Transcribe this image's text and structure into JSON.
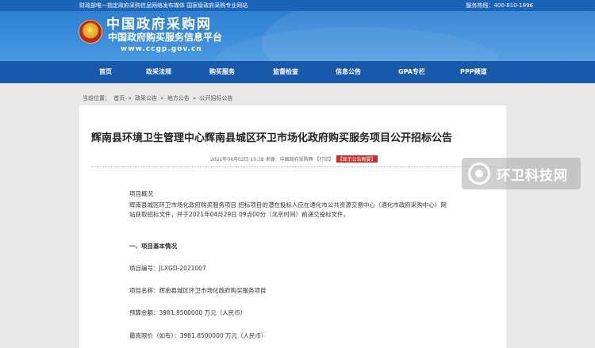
{
  "topbar": {
    "left": "财政部唯一指定政府采购信息网络发布媒体 国家级政府采购专业网站",
    "right": "服务热线：400-810-1996"
  },
  "header": {
    "title": "中国政府采购网",
    "subtitle": "中国政府购买服务信息平台",
    "url": "www.ccgp.gov.cn"
  },
  "nav": [
    "首页",
    "政采法规",
    "购买服务",
    "监督检查",
    "信息公告",
    "GPA专栏",
    "PPP频道"
  ],
  "breadcrumb": [
    "当前位置：",
    "首页",
    "»",
    "政采公告",
    "»",
    "地方公告",
    "»",
    "公开招标公告"
  ],
  "article": {
    "title": "辉南县环境卫生管理中心辉南县城区环卫市场化政府购买服务项目公开招标公告",
    "meta": "2021年04月02日 10:38 来源：中国政府采购网 【打印】",
    "badge": "【显示公告概要】",
    "overview_head": "项目概况",
    "overview": "辉南县城区环卫市场化政府购买服务项目 招标项目的潜在投标人应在通化市公共资源交易中心（通化市政府采购中心）网站获取招标文件，并于2021年04月29日 09点00分（北京时间）前递交投标文件。",
    "section1": "一、项目基本情况",
    "project_no": "项目编号：JLXGD-2021007",
    "project_name": "项目名称：辉南县城区环卫市场化政府购买服务项目",
    "budget": "预算金额：3981.8500000 万元（人民币）",
    "max_price": "最高限价（如有）：3981.8500000 万元（人民币）"
  },
  "watermark": "环卫科技网"
}
